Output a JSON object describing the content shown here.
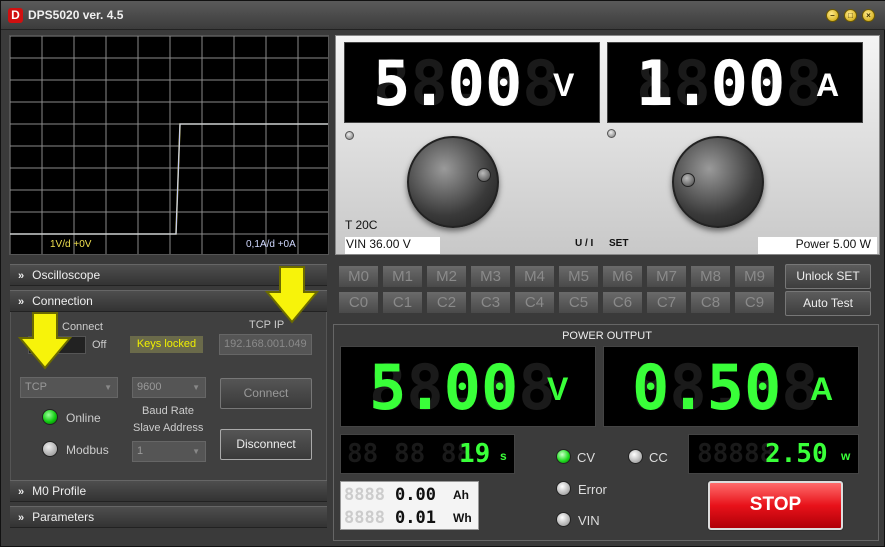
{
  "window": {
    "title": "DPS5020 ver. 4.5",
    "icon_letter": "D"
  },
  "oscilloscope": {
    "voltage_label": "1V/d +0V",
    "current_label": "0,1A/d +0A"
  },
  "set_display": {
    "voltage": {
      "ghost": "88.88",
      "value": "5.00",
      "unit": "V"
    },
    "current": {
      "ghost": "88.88",
      "value": "1.00",
      "unit": "A"
    },
    "temperature": "T 20C",
    "vin": "VIN 36.00 V",
    "mode_label": "U / I",
    "set_label": "SET",
    "power": "Power 5.00 W"
  },
  "panels": {
    "oscilloscope": "Oscilloscope",
    "connection": "Connection",
    "m0_profile": "M0 Profile",
    "parameters": "Parameters"
  },
  "connection": {
    "connect_label": "Connect",
    "off_label": "Off",
    "keys_locked": "Keys locked",
    "tcp_ip_label": "TCP IP",
    "tcp_ip_value": "192.168.001.049",
    "protocol": "TCP",
    "baud": "9600",
    "baud_label": "Baud Rate",
    "slave_label": "Slave Address",
    "slave": "1",
    "online_label": "Online",
    "modbus_label": "Modbus",
    "connect_btn": "Connect",
    "disconnect_btn": "Disconnect"
  },
  "memory": {
    "m": [
      "M0",
      "M1",
      "M2",
      "M3",
      "M4",
      "M5",
      "M6",
      "M7",
      "M8",
      "M9"
    ],
    "c": [
      "C0",
      "C1",
      "C2",
      "C3",
      "C4",
      "C5",
      "C6",
      "C7",
      "C8",
      "C9"
    ]
  },
  "buttons": {
    "unlock_set": "Unlock SET",
    "auto_test": "Auto Test",
    "stop": "STOP"
  },
  "output": {
    "title": "POWER OUTPUT",
    "voltage": {
      "ghost": "88.88",
      "value": "5.00",
      "unit": "V"
    },
    "current": {
      "ghost": "88.88",
      "value": "0.50",
      "unit": "A"
    },
    "time": {
      "ghost": "88 88 88",
      "value": "19",
      "unit": "s"
    },
    "power": {
      "ghost": "88888",
      "value": "2.50",
      "unit": "w"
    },
    "ah": {
      "ghost": "8888",
      "value": "0.00",
      "unit": "Ah"
    },
    "wh": {
      "ghost": "8888",
      "value": "0.01",
      "unit": "Wh"
    },
    "cv_label": "CV",
    "cc_label": "CC",
    "error_label": "Error",
    "vin_label": "VIN"
  },
  "colors": {
    "lcd_green": "#39ff39",
    "lcd_white": "#ffffff",
    "scope_voltage": "#e8e070",
    "scope_current": "#c0c8ff",
    "stop_red": "#e8121a",
    "keys_locked_yellow": "#f0f000"
  }
}
